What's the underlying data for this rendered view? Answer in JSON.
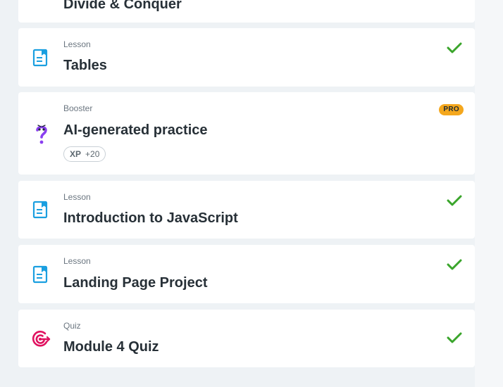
{
  "items": [
    {
      "type": "",
      "title": "Divide & Conquer",
      "status": "completed"
    },
    {
      "type": "Lesson",
      "title": "Tables",
      "status": "completed"
    },
    {
      "type": "Booster",
      "title": "AI-generated practice",
      "badge": "PRO",
      "xp_label": "XP",
      "xp_value": "+20"
    },
    {
      "type": "Lesson",
      "title": "Introduction to JavaScript",
      "status": "completed"
    },
    {
      "type": "Lesson",
      "title": "Landing Page Project",
      "status": "completed"
    },
    {
      "type": "Quiz",
      "title": "Module 4 Quiz",
      "status": "completed"
    }
  ],
  "colors": {
    "lesson_icon": "#1a9fe0",
    "booster_icon": "#8a3ff0",
    "quiz_icon": "#e0115f",
    "check": "#3aa52b",
    "pro_badge": "#f4a71d"
  },
  "icons": {
    "lesson": "lesson-document-icon",
    "booster": "question-mark-icon",
    "quiz": "target-icon",
    "check": "checkmark-icon"
  }
}
